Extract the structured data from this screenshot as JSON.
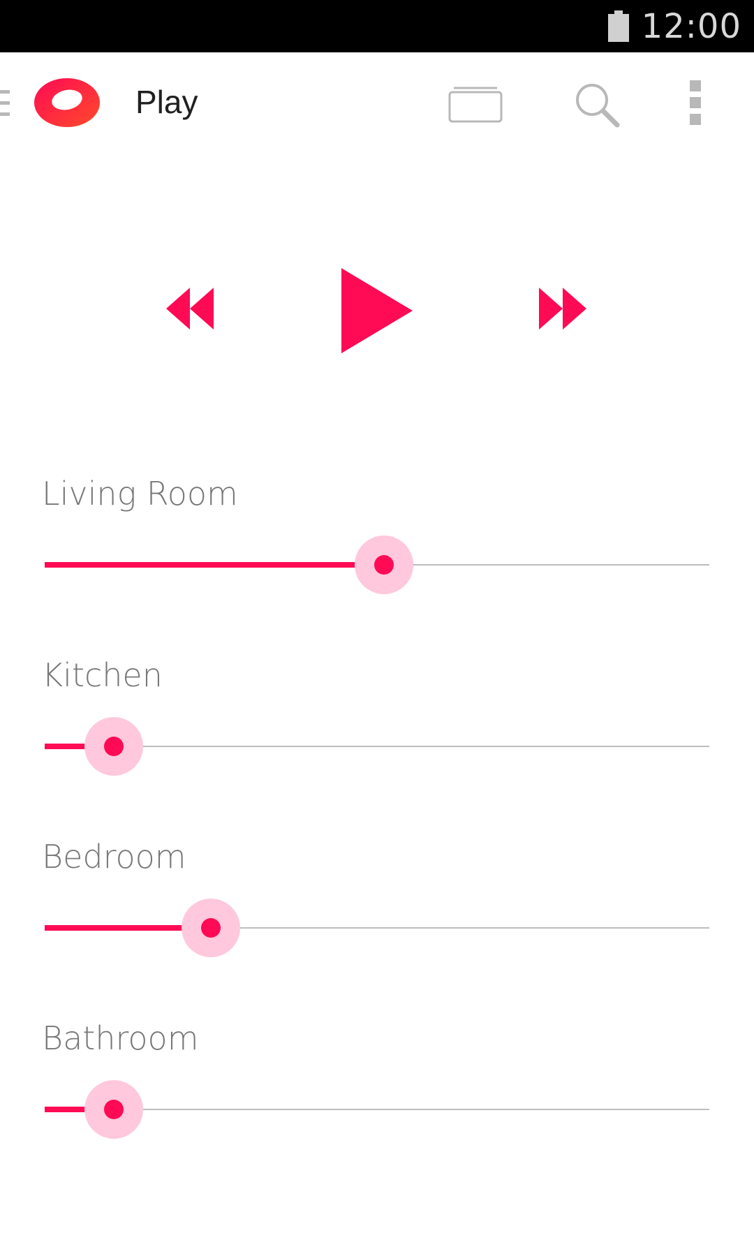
{
  "status_bar": {
    "time": "12:00",
    "icons": [
      "battery-icon"
    ]
  },
  "action_bar": {
    "title": "Play",
    "icons": [
      "drawer-icon",
      "app-logo",
      "cast-icon",
      "search-icon",
      "overflow-menu-icon"
    ]
  },
  "transport": {
    "controls": [
      "rewind-icon",
      "play-icon",
      "fast-forward-icon"
    ],
    "accent_color": "#ff0a55"
  },
  "rooms": [
    {
      "label": "Living Room",
      "volume": 0.51
    },
    {
      "label": "Kitchen",
      "volume": 0.104
    },
    {
      "label": "Bedroom",
      "volume": 0.25
    },
    {
      "label": "Bathroom",
      "volume": 0.104
    }
  ],
  "colors": {
    "accent": "#ff0a55",
    "halo": "#ffc8dc",
    "track": "#bdbdbd",
    "label": "#777777"
  }
}
